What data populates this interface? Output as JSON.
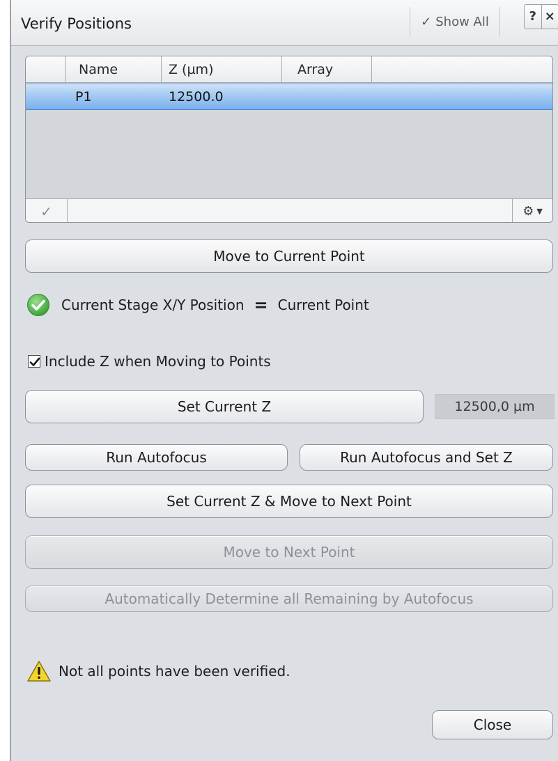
{
  "window": {
    "title": "Verify Positions",
    "show_all_label": "Show All",
    "help_label": "?",
    "close_label": "×"
  },
  "table": {
    "columns": [
      "",
      "Name",
      "Z (µm)",
      "Array",
      ""
    ],
    "rows": [
      {
        "name": "P1",
        "z": "12500.0",
        "array": ""
      }
    ]
  },
  "buttons": {
    "move_current": "Move to Current Point",
    "set_current_z": "Set Current Z",
    "run_autofocus": "Run Autofocus",
    "run_autofocus_set_z": "Run Autofocus and Set Z",
    "set_z_move_next": "Set Current Z & Move to Next Point",
    "move_next": "Move to Next Point",
    "auto_determine": "Automatically Determine all Remaining by Autofocus",
    "close": "Close"
  },
  "status": {
    "left": "Current Stage X/Y Position",
    "equals": "=",
    "right": "Current Point"
  },
  "include_z": {
    "label": "Include Z when Moving to Points",
    "checked": true
  },
  "z_value": "12500,0 µm",
  "warning": "Not all points have been verified.",
  "colors": {
    "selection": "#79b0ee",
    "ok_green": "#4db848",
    "warn_yellow": "#f3d52b"
  }
}
